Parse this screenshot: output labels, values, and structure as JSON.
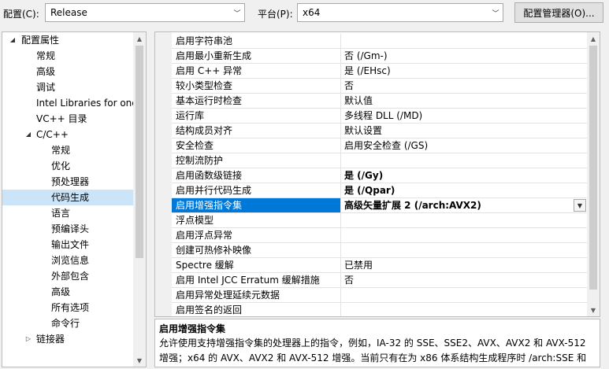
{
  "toolbar": {
    "config_label": "配置(C):",
    "config_value": "Release",
    "platform_label": "平台(P):",
    "platform_value": "x64",
    "config_manager_label": "配置管理器(O)..."
  },
  "tree": {
    "items": [
      {
        "label": "配置属性",
        "expander": "◢"
      },
      {
        "label": "常规"
      },
      {
        "label": "高级"
      },
      {
        "label": "调试"
      },
      {
        "label": "Intel Libraries for one"
      },
      {
        "label": "VC++ 目录"
      },
      {
        "label": "C/C++",
        "expander": "◢"
      },
      {
        "label": "常规"
      },
      {
        "label": "优化"
      },
      {
        "label": "预处理器"
      },
      {
        "label": "代码生成"
      },
      {
        "label": "语言"
      },
      {
        "label": "预编译头"
      },
      {
        "label": "输出文件"
      },
      {
        "label": "浏览信息"
      },
      {
        "label": "外部包含"
      },
      {
        "label": "高级"
      },
      {
        "label": "所有选项"
      },
      {
        "label": "命令行"
      },
      {
        "label": "链接器",
        "expander": "▷"
      }
    ]
  },
  "grid": {
    "rows": [
      {
        "name": "启用字符串池",
        "value": ""
      },
      {
        "name": "启用最小重新生成",
        "value": "否 (/Gm-)"
      },
      {
        "name": "启用 C++ 异常",
        "value": "是 (/EHsc)"
      },
      {
        "name": "较小类型检查",
        "value": "否"
      },
      {
        "name": "基本运行时检查",
        "value": "默认值"
      },
      {
        "name": "运行库",
        "value": "多线程 DLL (/MD)"
      },
      {
        "name": "结构成员对齐",
        "value": "默认设置"
      },
      {
        "name": "安全检查",
        "value": "启用安全检查 (/GS)"
      },
      {
        "name": "控制流防护",
        "value": ""
      },
      {
        "name": "启用函数级链接",
        "value": "是 (/Gy)"
      },
      {
        "name": "启用并行代码生成",
        "value": "是 (/Qpar)"
      },
      {
        "name": "启用增强指令集",
        "value": "高级矢量扩展 2 (/arch:AVX2)"
      },
      {
        "name": "浮点模型",
        "value": ""
      },
      {
        "name": "启用浮点异常",
        "value": ""
      },
      {
        "name": "创建可热修补映像",
        "value": ""
      },
      {
        "name": "Spectre 缓解",
        "value": "已禁用"
      },
      {
        "name": "启用 Intel JCC Erratum 缓解措施",
        "value": "否"
      },
      {
        "name": "启用异常处理延续元数据",
        "value": ""
      },
      {
        "name": "启用签名的返回",
        "value": ""
      }
    ]
  },
  "description": {
    "title": "启用增强指令集",
    "text": "允许使用支持增强指令集的处理器上的指令，例如，IA-32 的 SSE、SSE2、AVX、AVX2 和 AVX-512 增强；x64 的 AVX、AVX2 和 AVX-512 增强。当前只有在为 x86 体系结构生成程序时 /arch:SSE 和"
  },
  "icons": {
    "dropdown": "chevron-down-icon",
    "expanded": "triangle-expanded-icon",
    "collapsed": "triangle-collapsed-icon"
  },
  "colors": {
    "selection": "#0078d7",
    "tree_selection": "#cce4f7"
  }
}
